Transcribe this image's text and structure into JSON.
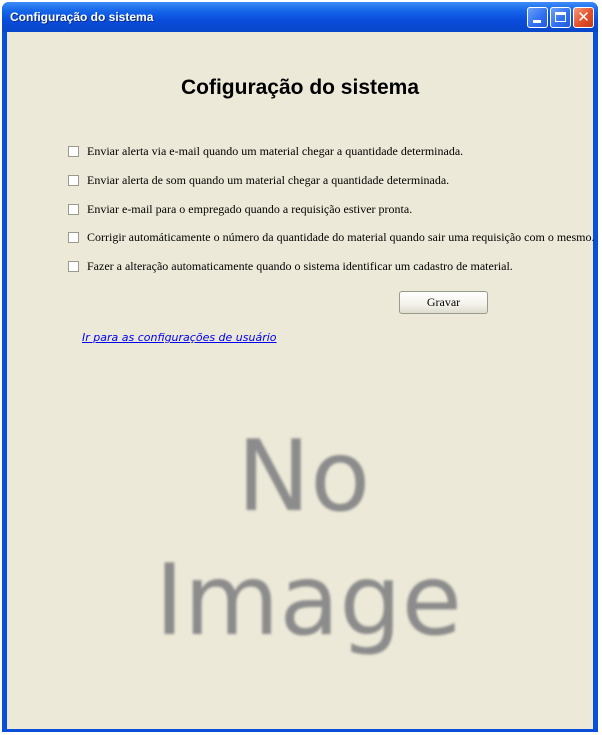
{
  "window": {
    "title": "Configuração do sistema",
    "controls": {
      "minimize": "minimize",
      "maximize": "maximize",
      "close": "close"
    }
  },
  "page": {
    "heading": "Cofiguração do sistema",
    "options": [
      {
        "label": "Enviar alerta via e-mail quando um material chegar a quantidade determinada.",
        "checked": false
      },
      {
        "label": "Enviar alerta de som quando um material chegar a quantidade determinada.",
        "checked": false
      },
      {
        "label": "Enviar e-mail para o empregado quando a requisição estiver pronta.",
        "checked": false
      },
      {
        "label": "Corrigir automáticamente o número da quantidade do material quando sair uma requisição com o mesmo.",
        "checked": false
      },
      {
        "label": "Fazer a alteração automaticamente quando o sistema identificar um cadastro de material.",
        "checked": false
      }
    ],
    "save_button": "Gravar",
    "user_settings_link": "Ir para as configurações de usuário",
    "placeholder_image": {
      "line1": "No",
      "line2": "Image"
    }
  },
  "colors": {
    "titlebar": "#0a4fd8",
    "background": "#ece9d8",
    "link": "#0000ee",
    "close_button": "#e2502a"
  }
}
